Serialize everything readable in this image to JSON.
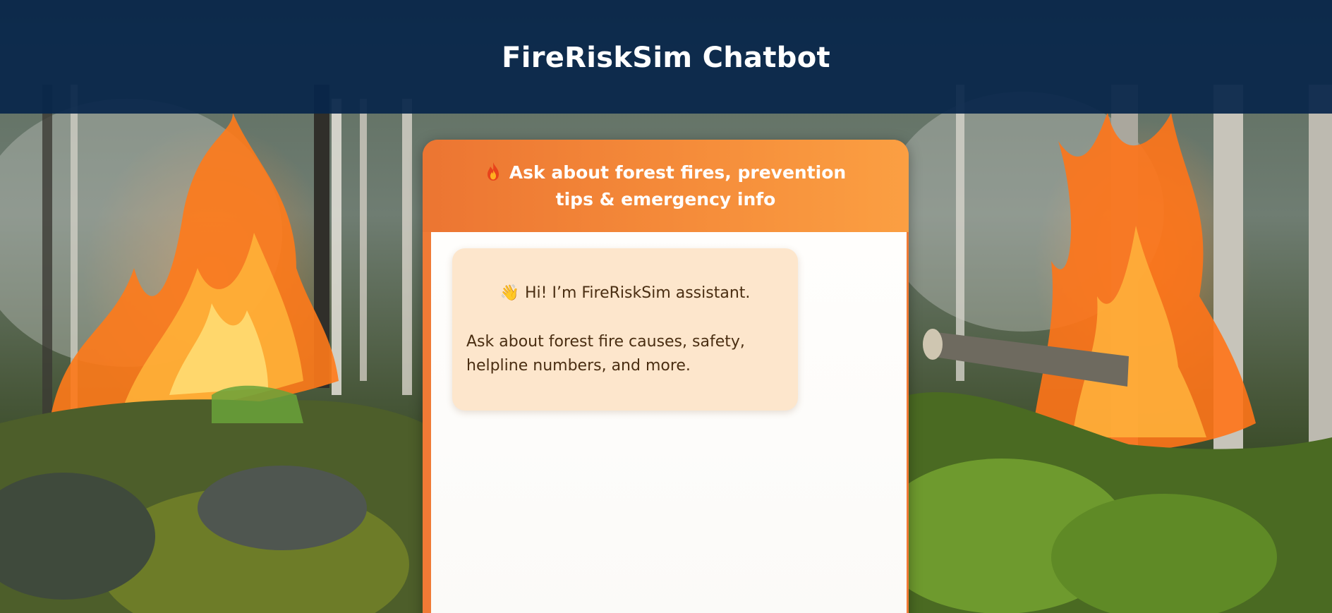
{
  "header": {
    "title": "FireRiskSim Chatbot"
  },
  "chat": {
    "banner_icon": "flame-icon",
    "banner_text": "Ask about forest fires, prevention tips & emergency info",
    "messages": [
      {
        "sender": "bot",
        "icon": "waving-hand-icon",
        "greeting": "Hi! I’m FireRiskSim assistant.",
        "body": "Ask about forest fire causes, safety, helpline numbers, and more."
      }
    ]
  },
  "colors": {
    "header_bg": "#08264a",
    "accent_orange": "#f07a35",
    "bubble_bg": "#fde6cc",
    "bubble_text": "#4a2e12"
  }
}
